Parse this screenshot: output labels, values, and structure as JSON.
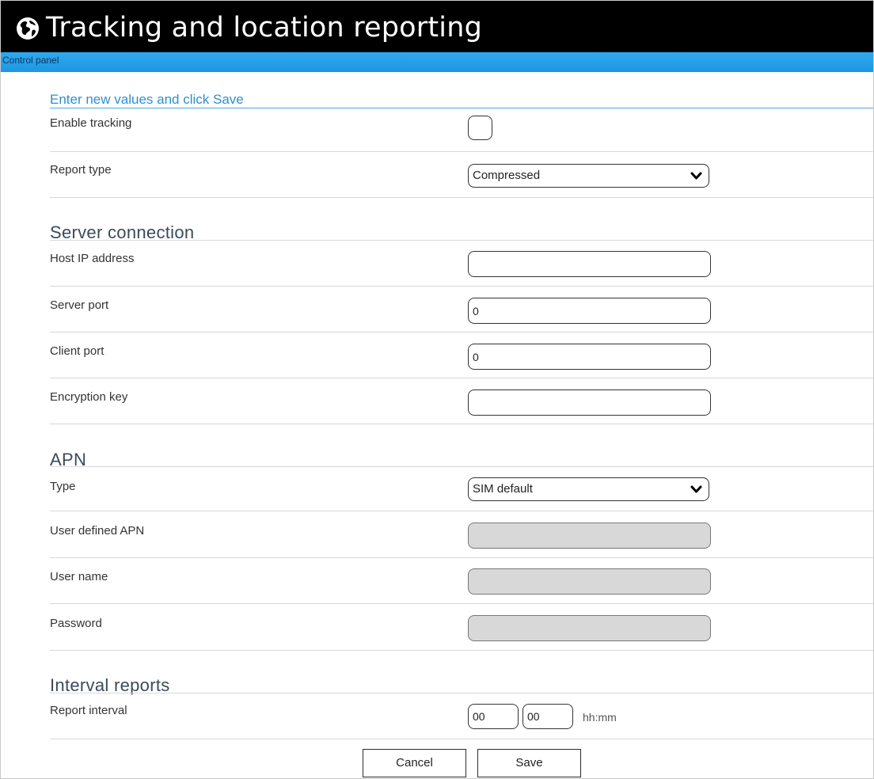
{
  "header": {
    "title": "Tracking and location reporting",
    "subtitle": "Control panel",
    "logo_icon": "globe-icon"
  },
  "form": {
    "instruction": "Enter new values and click Save",
    "enable_tracking": {
      "label": "Enable tracking",
      "checked": false
    },
    "report_type": {
      "label": "Report type",
      "value": "Compressed"
    }
  },
  "server": {
    "heading": "Server connection",
    "host_ip": {
      "label": "Host IP address",
      "value": ""
    },
    "server_port": {
      "label": "Server port",
      "value": "0"
    },
    "client_port": {
      "label": "Client port",
      "value": "0"
    },
    "encryption_key": {
      "label": "Encryption key",
      "value": ""
    }
  },
  "apn": {
    "heading": "APN",
    "type": {
      "label": "Type",
      "value": "SIM default"
    },
    "user_defined": {
      "label": "User defined APN",
      "value": "",
      "disabled": true
    },
    "user_name": {
      "label": "User name",
      "value": "",
      "disabled": true
    },
    "password": {
      "label": "Password",
      "value": "",
      "disabled": true
    }
  },
  "interval": {
    "heading": "Interval reports",
    "label": "Report interval",
    "hours": "00",
    "minutes": "00",
    "format_hint": "hh:mm"
  },
  "actions": {
    "cancel_label": "Cancel",
    "save_label": "Save"
  },
  "colors": {
    "title_bar": "#000000",
    "sub_bar": "#1d97e2",
    "instruction": "#2d8fcf",
    "disabled_field": "#d8d8d8"
  }
}
